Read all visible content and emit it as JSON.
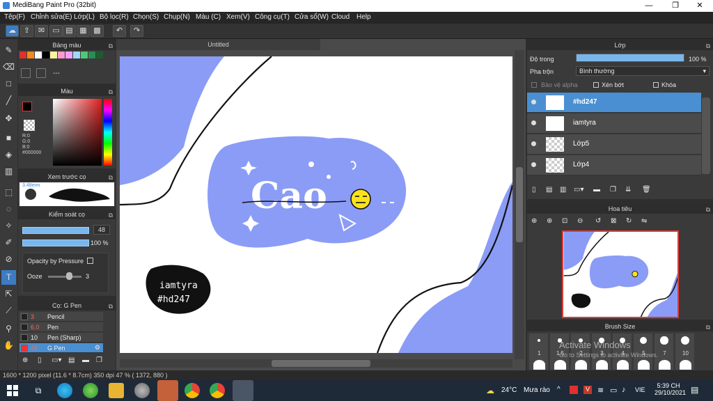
{
  "window": {
    "title": "MediBang Paint Pro (32bit)",
    "minimize": "—",
    "maximize": "❐",
    "close": "✕"
  },
  "menu": [
    "Tệp(F)",
    "Chỉnh sửa(E)",
    "Lớp(L)",
    "Bộ lọc(R)",
    "Chọn(S)",
    "Chụp(N)",
    "Màu (C)",
    "Xem(V)",
    "Công cụ(T)",
    "Cửa sổ(W)",
    "Cloud",
    "Help"
  ],
  "document": {
    "tab": "Untitled"
  },
  "palette_panel": {
    "title": "Bảng màu",
    "dash": "---",
    "swatches": [
      "#e0302a",
      "#f08c1e",
      "#ffffff",
      "#000000",
      "#f5f5a0",
      "#ff9ad0",
      "#f0a0ff",
      "#a0d8ff",
      "#50c878",
      "#2e8b57",
      "#1e5c30"
    ]
  },
  "color_panel": {
    "title": "Màu",
    "r": "R:0",
    "g": "G:0",
    "b": "B:0",
    "hex": "#000000"
  },
  "preview_panel": {
    "title": "Xem trước cọ",
    "size": "3.48mm"
  },
  "brush_control": {
    "title": "Kiểm soát cọ",
    "size_value": "48",
    "opacity_value": "100 %",
    "size_fraction": 0.9,
    "opacity_fraction": 1.0,
    "pressure_label": "Opacity by Pressure",
    "ooze_label": "Ooze",
    "ooze_value": "3"
  },
  "brush_list": {
    "title": "Cọ: G Pen",
    "items": [
      {
        "size": "3",
        "name": "Pencil"
      },
      {
        "size": "6.0",
        "name": "Pen"
      },
      {
        "size": "10",
        "name": "Pen (Sharp)"
      },
      {
        "size": "48",
        "name": "G Pen"
      }
    ]
  },
  "layer_panel": {
    "title": "Lớp",
    "opacity_label": "Độ trong",
    "opacity_value": "100 %",
    "opacity_fraction": 1.0,
    "blend_label": "Pha trộn",
    "blend_value": "Bình thường",
    "protect_alpha": "Bảo vệ alpha",
    "clipping": "Xén bớt",
    "lock": "Khóa",
    "layers": [
      "#hd247",
      "iamtyra",
      "Lớp5",
      "Lớp4"
    ]
  },
  "navigator_panel": {
    "title": "Hoa tiêu"
  },
  "brush_size_panel": {
    "title": "Brush Size",
    "sizes": [
      "1",
      "1.5",
      "2",
      "3",
      "4",
      "5",
      "7",
      "10"
    ]
  },
  "canvas_art": {
    "sticker_text": "Cao",
    "tag_line1": "iamtyra",
    "tag_line2": "#hd247",
    "bg_color": "#8b9cf6"
  },
  "watermark": {
    "line1": "Activate Windows",
    "line2": "Go to Settings to activate Windows."
  },
  "status": {
    "text": "1600 * 1200 pixel   (11.6 * 8.7cm)   350 dpi   47 %   ( 1372, 880 )"
  },
  "taskbar": {
    "weather_temp": "24°C",
    "weather_desc": "Mưa rào",
    "lang": "VIE",
    "time": "5:39 CH",
    "date": "29/10/2021"
  }
}
